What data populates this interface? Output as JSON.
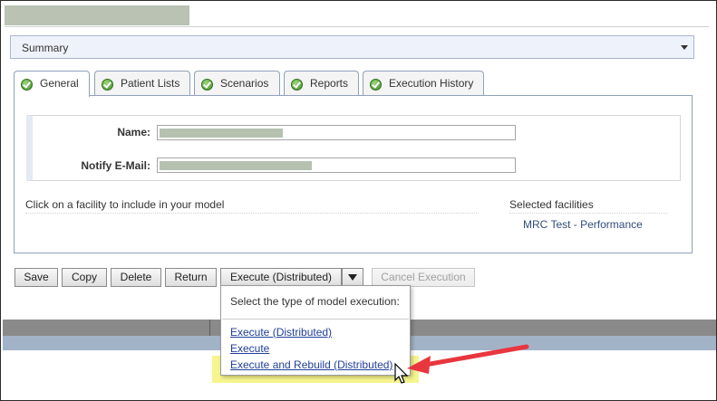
{
  "summary": {
    "label": "Summary"
  },
  "tabs": [
    {
      "label": "General",
      "active": true
    },
    {
      "label": "Patient Lists"
    },
    {
      "label": "Scenarios"
    },
    {
      "label": "Reports"
    },
    {
      "label": "Execution History"
    }
  ],
  "form": {
    "name_label": "Name:",
    "email_label": "Notify E-Mail:"
  },
  "facilities": {
    "instruction": "Click on a facility to include in your model",
    "selected_header": "Selected facilities",
    "selected": [
      "MRC Test - Performance"
    ]
  },
  "buttons": {
    "save": "Save",
    "copy": "Copy",
    "delete": "Delete",
    "return": "Return",
    "execute_distributed": "Execute (Distributed)",
    "cancel_execution": "Cancel Execution"
  },
  "menu": {
    "header": "Select the type of model execution:",
    "items": [
      "Execute (Distributed)",
      "Execute",
      "Execute and Rebuild (Distributed)"
    ]
  },
  "colors": {
    "accent_link": "#1f3f9a",
    "highlight": "#f5f37a",
    "annotation_arrow": "#e8363f",
    "tab_border": "#8fa1ba"
  },
  "icons": {
    "tab_status": "check-circle-icon",
    "dropdown": "chevron-down-icon",
    "pointer": "mouse-pointer-icon",
    "annotation": "red-arrow-icon"
  }
}
